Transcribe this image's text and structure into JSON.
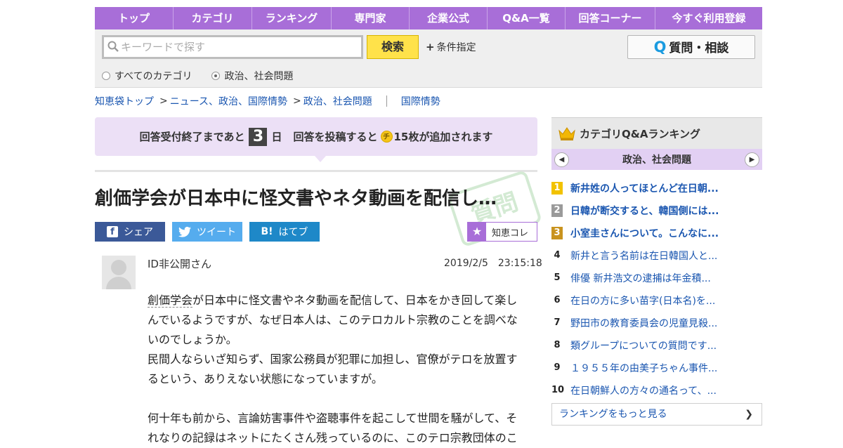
{
  "nav": {
    "items": [
      "トップ",
      "カテゴリ",
      "ランキング",
      "専門家",
      "企業公式",
      "Q&A一覧",
      "回答コーナー",
      "今すぐ利用登録"
    ]
  },
  "search": {
    "placeholder": "キーワードで探す",
    "button_label": "検索",
    "conditions_label": "条件指定",
    "ask_label": "質問・相談",
    "radio_all": "すべてのカテゴリ",
    "radio_current": "政治、社会問題"
  },
  "breadcrumb": {
    "items": [
      "知恵袋トップ",
      "ニュース、政治、国際情勢",
      "政治、社会問題"
    ],
    "related": "国際情勢"
  },
  "banner": {
    "prefix": "回答受付終了まであと",
    "days": "3",
    "unit": "日",
    "reward_prefix": "回答を投稿すると",
    "coin": "チ",
    "reward_suffix": "15枚が追加されます"
  },
  "question": {
    "title": "創価学会が日本中に怪文書やネタ動画を配信し…",
    "stamp": "質問",
    "user": "ID非公開さん",
    "posted_at": "2019/2/5　23:15:18",
    "keyword": "創価学会",
    "para1_rest": "が日本中に怪文書やネタ動画を配信して、日本をかき回して楽しんでいるようですが、なぜ日本人は、このテロカルト宗教のことを調べないのでしょうか。",
    "para2": "民間人ならいざ知らず、国家公務員が犯罪に加担し、官僚がテロを放置するという、ありえない状態になっていますが。",
    "para3": "何十年も前から、言論妨害事件や盗聴事件を起こして世間を騒がして、それなりの記録はネットにたくさん残っているのに、このテロ宗教団体のこ"
  },
  "share": {
    "facebook": "シェア",
    "twitter": "ツイート",
    "hatena": "はてブ",
    "chiekore": "知恵コレ"
  },
  "ranking": {
    "title": "カテゴリQ&Aランキング",
    "category": "政治、社会問題",
    "items": [
      {
        "rank": "1",
        "title": "新井姓の人ってほとんど在日朝..."
      },
      {
        "rank": "2",
        "title": "日韓が断交すると、韓国側には..."
      },
      {
        "rank": "3",
        "title": "小室圭さんについて。こんなに..."
      },
      {
        "rank": "4",
        "title": "新井と言う名前は在日韓国人と..."
      },
      {
        "rank": "5",
        "title": "俳優 新井浩文の逮捕は年金積..."
      },
      {
        "rank": "6",
        "title": "在日の方に多い苗字(日本名)を..."
      },
      {
        "rank": "7",
        "title": "野田市の教育委員会の児童見殺..."
      },
      {
        "rank": "8",
        "title": "類グループについての質問です..."
      },
      {
        "rank": "9",
        "title": "１９５５年の由美子ちゃん事件..."
      },
      {
        "rank": "10",
        "title": "在日朝鮮人の方々の通名って、..."
      }
    ],
    "more_label": "ランキングをもっと見る",
    "medal_colors": [
      "#f2c200",
      "#9a9a9a",
      "#c9931e"
    ]
  },
  "colors": {
    "accent": "#a86ed8",
    "link": "#1a56b0",
    "search_button": "#ffe24a"
  }
}
